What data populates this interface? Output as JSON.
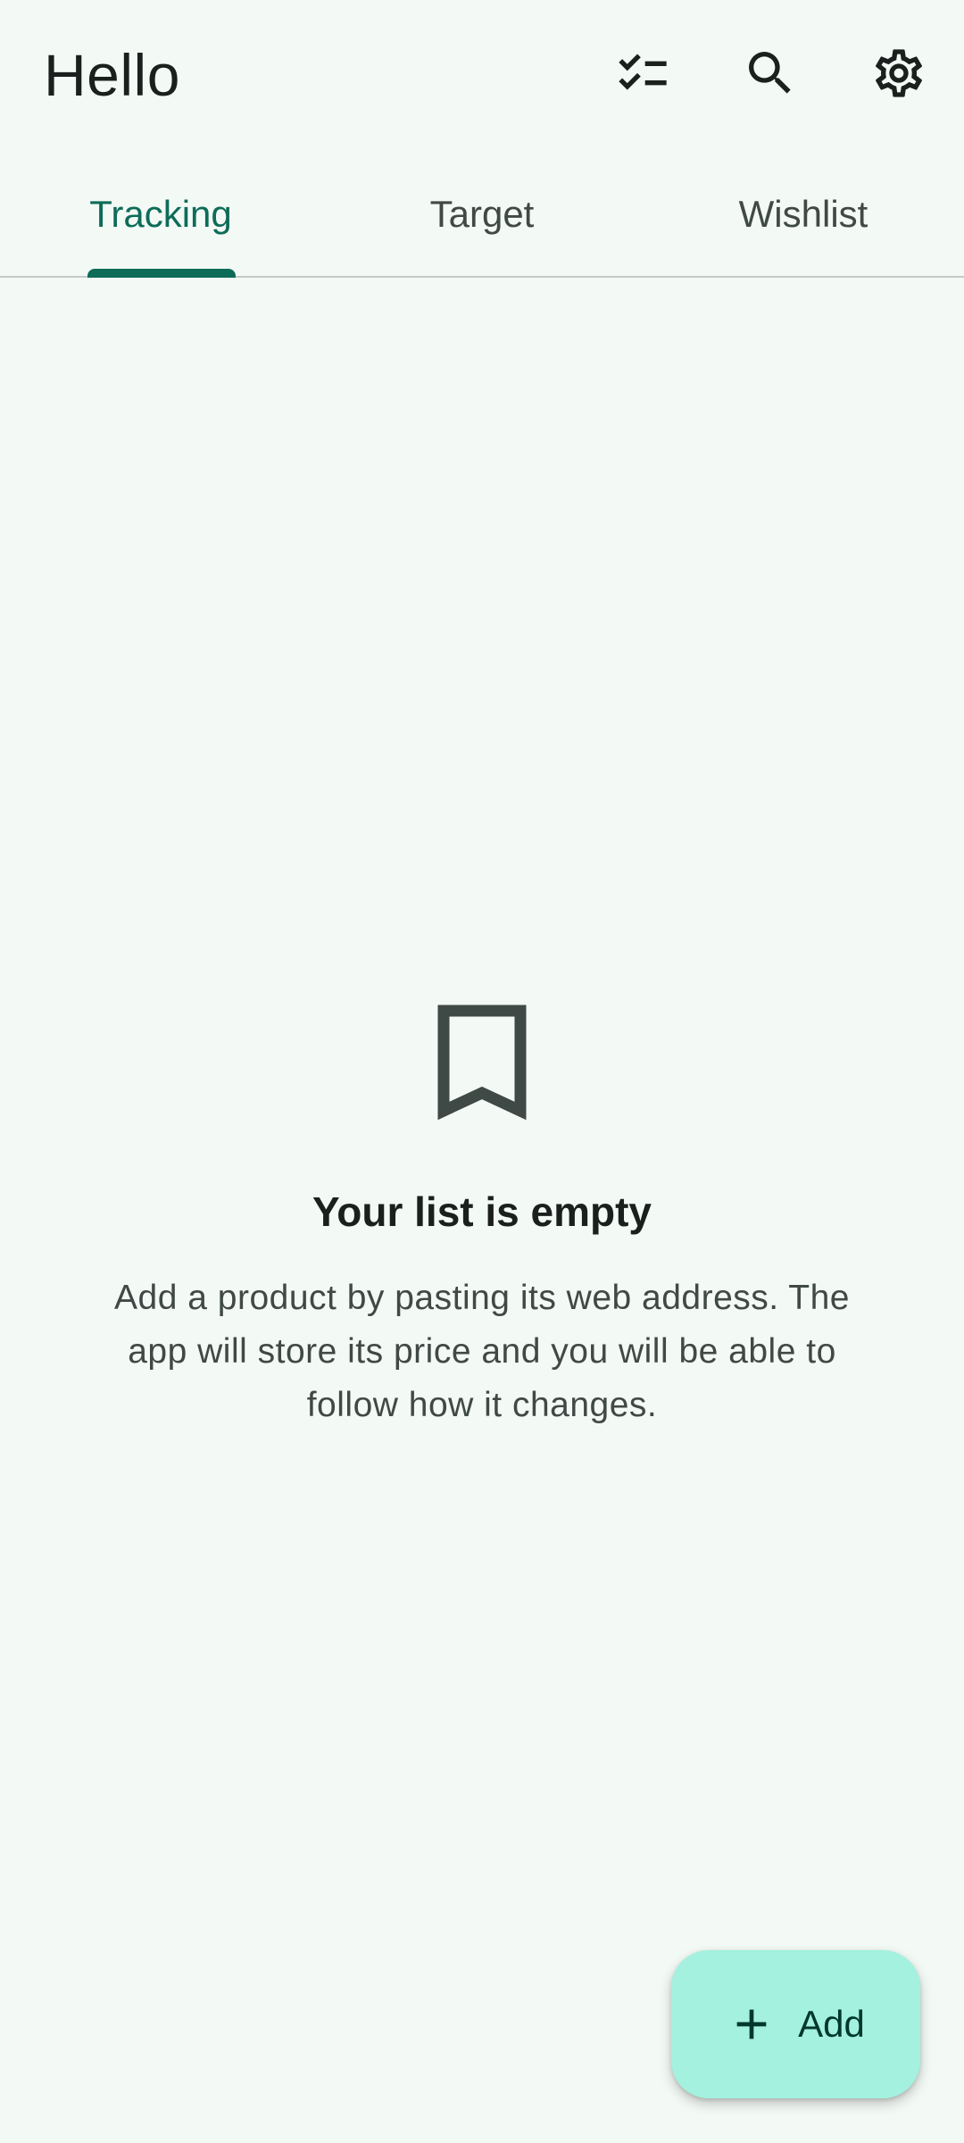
{
  "app_bar": {
    "title": "Hello",
    "actions": [
      {
        "icon": "checklist-icon"
      },
      {
        "icon": "search-icon"
      },
      {
        "icon": "gear-icon"
      }
    ]
  },
  "tabs": [
    {
      "label": "Tracking",
      "selected": true
    },
    {
      "label": "Target",
      "selected": false
    },
    {
      "label": "Wishlist",
      "selected": false
    }
  ],
  "empty_state": {
    "icon": "bookmark-icon",
    "title": "Your list is empty",
    "description": "Add a product by pasting its web address. The app will store its price and you will be able to follow how it changes."
  },
  "fab": {
    "icon": "plus-icon",
    "label": "Add"
  },
  "colors": {
    "background": "#f3f9f5",
    "accent": "#0d6c58",
    "fab_background": "#a3f1de",
    "fab_text": "#00382c",
    "text_primary": "#1b1f1d",
    "text_secondary": "#3f4945"
  }
}
